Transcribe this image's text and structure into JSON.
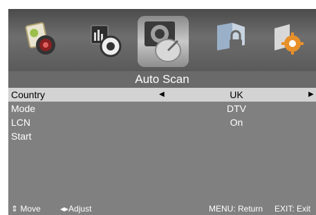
{
  "menu": {
    "title": "Auto Scan",
    "icons": [
      "picture-icon",
      "sound-icon",
      "channel-icon",
      "lock-icon",
      "setup-icon"
    ],
    "selected_icon": "channel-icon"
  },
  "rows": [
    {
      "label": "Country",
      "value": "UK",
      "selected": true
    },
    {
      "label": "Mode",
      "value": "DTV"
    },
    {
      "label": "LCN",
      "value": "On"
    },
    {
      "label": "Start",
      "value": ""
    }
  ],
  "footer": {
    "move_label": "Move",
    "adjust_label": "Adjust",
    "menu_hint": "MENU: Return",
    "exit_hint": "EXIT: Exit"
  },
  "colors": {
    "highlight": "#d3d3d3",
    "panel": "#808080",
    "title_bar": "#6a6a6a"
  }
}
